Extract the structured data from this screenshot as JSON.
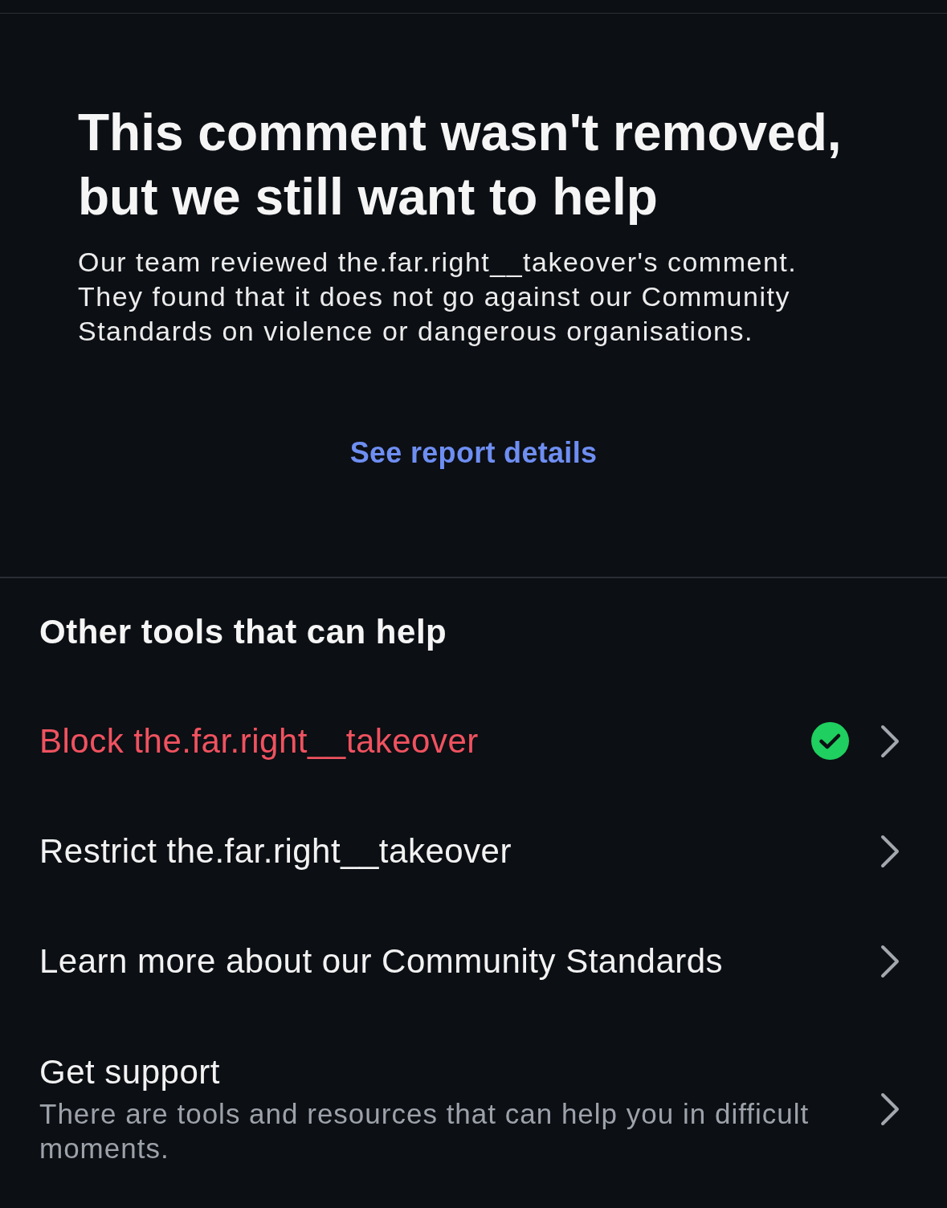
{
  "header": {
    "title": "This comment wasn't removed, but we still want to help",
    "body": "Our team reviewed the.far.right__takeover's comment. They found that it does not go against our Community Standards on violence or dangerous organisations.",
    "link": "See report details"
  },
  "tools": {
    "heading": "Other tools that can help",
    "items": [
      {
        "label": "Block the.far.right__takeover",
        "kind": "destructive",
        "completed": true
      },
      {
        "label": "Restrict the.far.right__takeover",
        "kind": "default",
        "completed": false
      },
      {
        "label": "Learn more about our Community Standards",
        "kind": "default",
        "completed": false
      },
      {
        "label": "Get support",
        "kind": "default",
        "completed": false,
        "description": "There are tools and resources that can help you in difficult moments."
      }
    ]
  }
}
